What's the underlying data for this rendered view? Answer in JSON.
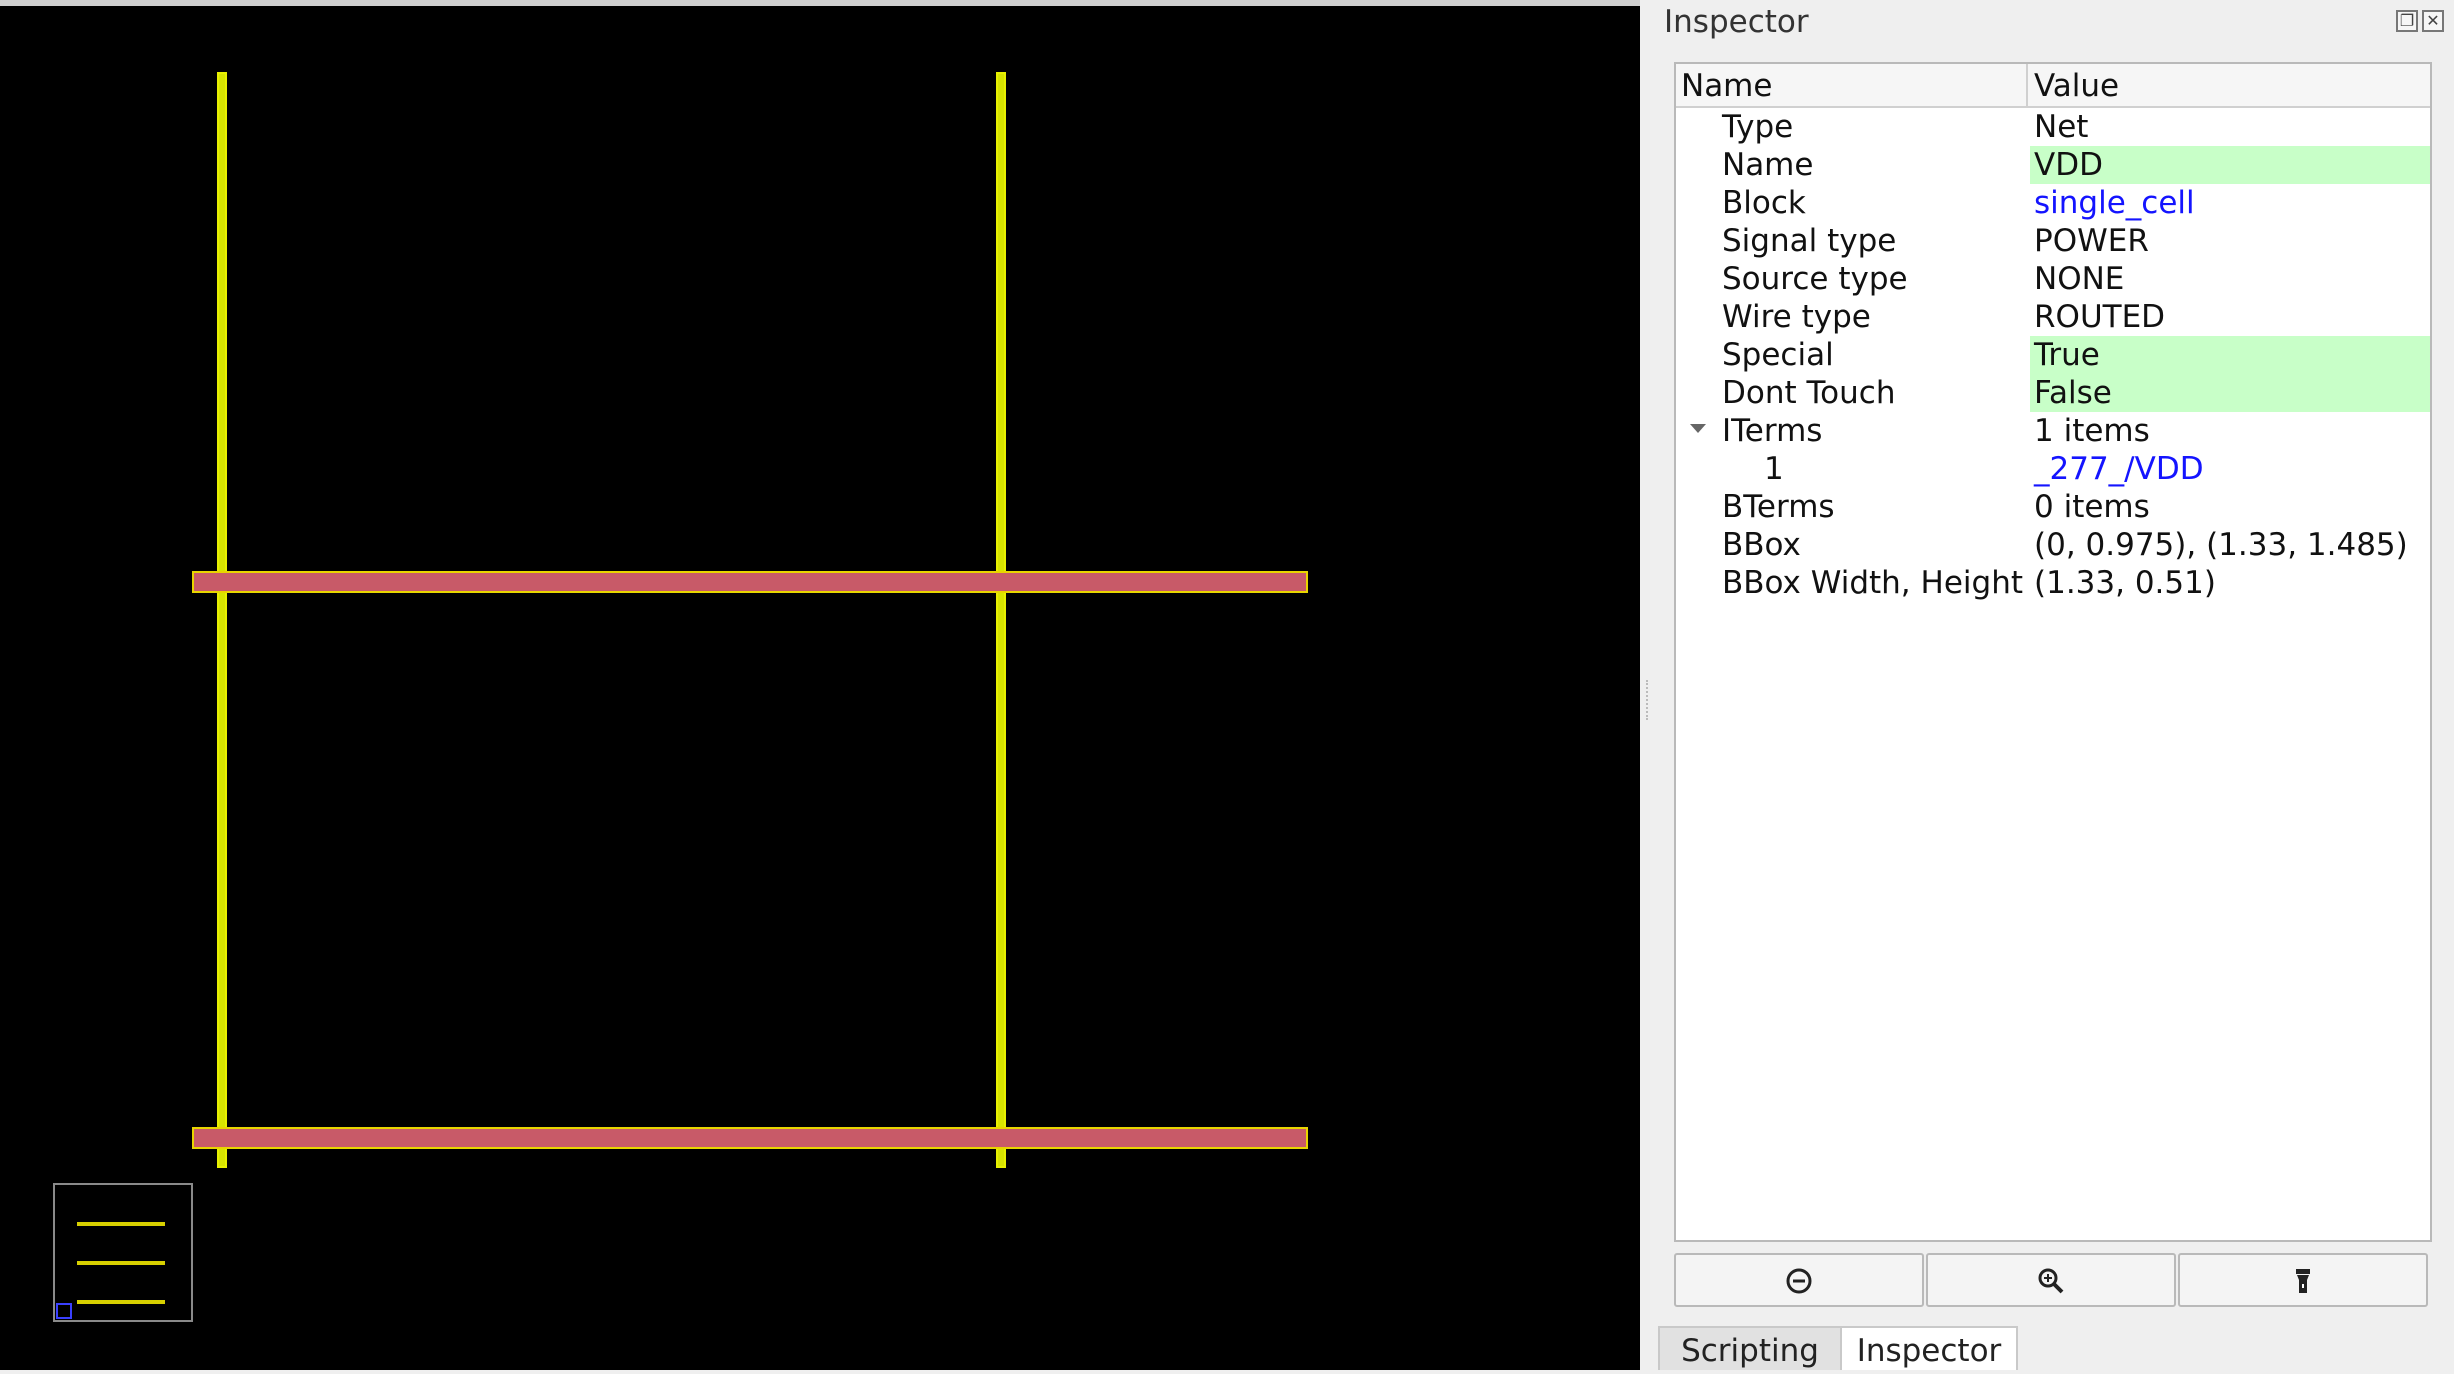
{
  "layout_view": {
    "description_items": []
  },
  "inspector": {
    "title": "Inspector",
    "float_icon": "float-icon",
    "close_icon": "close-icon",
    "columns": {
      "name": "Name",
      "value": "Value"
    },
    "rows": [
      {
        "name": "Type",
        "value": "Net",
        "highlight": false,
        "link": false
      },
      {
        "name": "Name",
        "value": "VDD",
        "highlight": true,
        "link": false
      },
      {
        "name": "Block",
        "value": "single_cell",
        "highlight": false,
        "link": true
      },
      {
        "name": "Signal type",
        "value": "POWER",
        "highlight": false,
        "link": false
      },
      {
        "name": "Source type",
        "value": "NONE",
        "highlight": false,
        "link": false
      },
      {
        "name": "Wire type",
        "value": "ROUTED",
        "highlight": false,
        "link": false
      },
      {
        "name": "Special",
        "value": "True",
        "highlight": true,
        "link": false
      },
      {
        "name": "Dont Touch",
        "value": "False",
        "highlight": true,
        "link": false
      },
      {
        "name": "ITerms",
        "value": "1 items",
        "highlight": false,
        "link": false,
        "expanded": true
      },
      {
        "name": "1",
        "value": "_277_/VDD",
        "highlight": false,
        "link": true,
        "child": true
      },
      {
        "name": "BTerms",
        "value": "0 items",
        "highlight": false,
        "link": false
      },
      {
        "name": "BBox",
        "value": "(0, 0.975), (1.33, 1.485)",
        "highlight": false,
        "link": false
      },
      {
        "name": "BBox Width, Height",
        "value": "(1.33, 0.51)",
        "highlight": false,
        "link": false
      }
    ],
    "buttons": [
      {
        "name": "zoom-out-button",
        "icon": "zoom-out-icon"
      },
      {
        "name": "zoom-in-button",
        "icon": "zoom-in-icon"
      },
      {
        "name": "highlight-button",
        "icon": "flashlight-icon"
      }
    ]
  },
  "tabs": [
    {
      "label": "Scripting",
      "active": false
    },
    {
      "label": "Inspector",
      "active": true
    }
  ],
  "colors": {
    "wire": "#d7e400",
    "rail_fill": "#c85a68",
    "highlight": "#c8ffc8",
    "link": "#1414ff"
  }
}
